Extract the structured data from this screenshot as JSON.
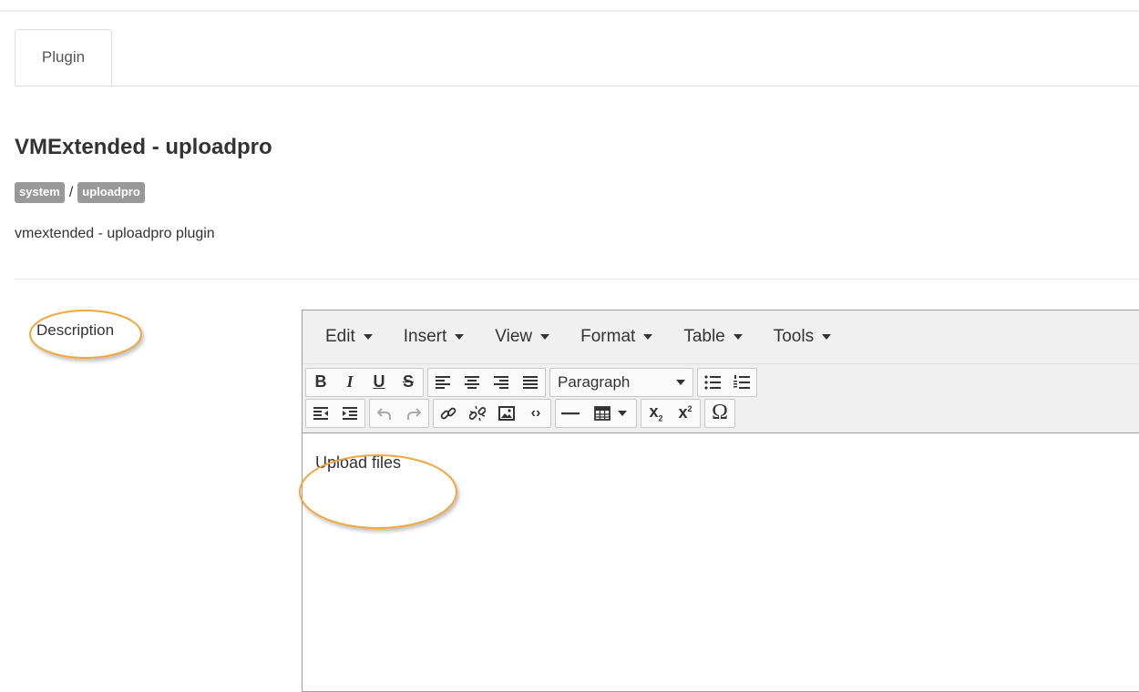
{
  "tabs": [
    {
      "label": "Plugin"
    }
  ],
  "plugin": {
    "title": "VMExtended - uploadpro",
    "badges": [
      "system",
      "uploadpro"
    ],
    "separator": "/",
    "description": "vmextended - uploadpro plugin"
  },
  "field": {
    "label": "Description"
  },
  "editor": {
    "menus": [
      "Edit",
      "Insert",
      "View",
      "Format",
      "Table",
      "Tools"
    ],
    "format_select": "Paragraph",
    "content": "Upload files",
    "icons_row1": [
      "bold-icon",
      "italic-icon",
      "underline-icon",
      "strikethrough-icon",
      "align-left-icon",
      "align-center-icon",
      "align-right-icon",
      "align-justify-icon",
      "format-select",
      "bullet-list-icon",
      "numbered-list-icon"
    ],
    "icons_row2": [
      "outdent-icon",
      "indent-icon",
      "undo-icon",
      "redo-icon",
      "link-icon",
      "unlink-icon",
      "image-icon",
      "code-icon",
      "horizontal-rule-icon",
      "table-icon",
      "subscript-icon",
      "superscript-icon",
      "special-character-icon"
    ],
    "glyphs": {
      "bold": "B",
      "italic": "I",
      "underline": "U",
      "strike": "S",
      "sub": "x",
      "sub_small": "2",
      "sup": "x",
      "sup_small": "2",
      "omega": "Ω",
      "code": "‹›"
    }
  },
  "colors": {
    "highlight": "#f2a53a",
    "badge": "#999999",
    "toolbar": "#f0f0f0"
  }
}
